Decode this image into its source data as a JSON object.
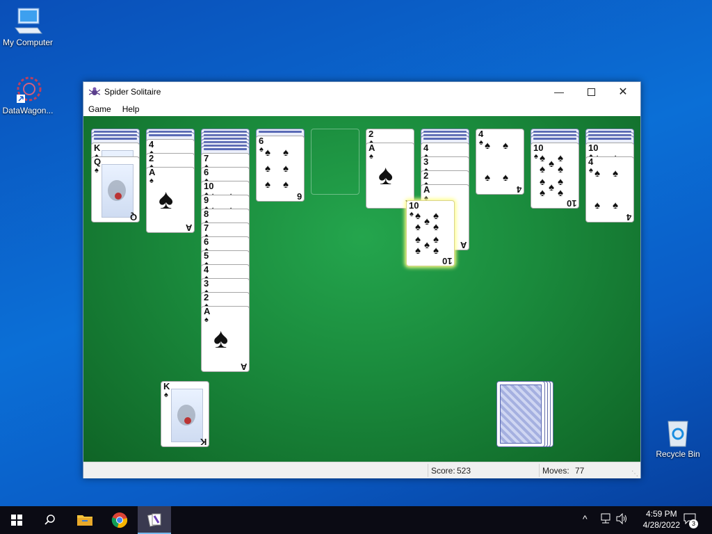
{
  "desktop": {
    "icons": [
      {
        "label": "My Computer",
        "icon": "computer-icon"
      },
      {
        "label": "DataWagon...",
        "icon": "datawagon-shortcut-icon"
      },
      {
        "label": "Recycle Bin",
        "icon": "recycle-bin-icon"
      }
    ]
  },
  "window": {
    "title": "Spider Solitaire",
    "menu": [
      "Game",
      "Help"
    ],
    "controls": {
      "minimize": "minimize-icon",
      "maximize": "maximize-icon",
      "close": "close-icon"
    }
  },
  "game": {
    "suit_symbol": "♠",
    "columns": [
      {
        "backs": 3,
        "faceup": [
          "K",
          "Q"
        ]
      },
      {
        "backs": 2,
        "faceup": [
          "4",
          "2",
          "A"
        ]
      },
      {
        "backs": 6,
        "faceup": [
          "7",
          "6",
          "10",
          "9",
          "8",
          "7",
          "6",
          "5",
          "4",
          "3",
          "2",
          "A"
        ]
      },
      {
        "backs": 1,
        "faceup": [
          "6"
        ]
      },
      {
        "backs": 0,
        "faceup": []
      },
      {
        "backs": 0,
        "faceup": [
          "2",
          "A"
        ]
      },
      {
        "backs": 3,
        "faceup": [
          "4",
          "3",
          "2",
          "A"
        ]
      },
      {
        "backs": 0,
        "faceup": [
          "4"
        ]
      },
      {
        "backs": 3,
        "faceup": [
          "10"
        ]
      },
      {
        "backs": 3,
        "faceup": [
          "10",
          "4"
        ]
      }
    ],
    "dragged_card": "10",
    "completed_foundation_top": "K",
    "stock_piles": 4
  },
  "status": {
    "score_label": "Score:",
    "score": "523",
    "moves_label": "Moves:",
    "moves": "77"
  },
  "taskbar": {
    "items": [
      "start-icon",
      "search-icon",
      "file-explorer-icon",
      "chrome-icon",
      "spider-solitaire-icon"
    ],
    "time": "4:59 PM",
    "date": "4/28/2022",
    "notification_count": "3"
  }
}
